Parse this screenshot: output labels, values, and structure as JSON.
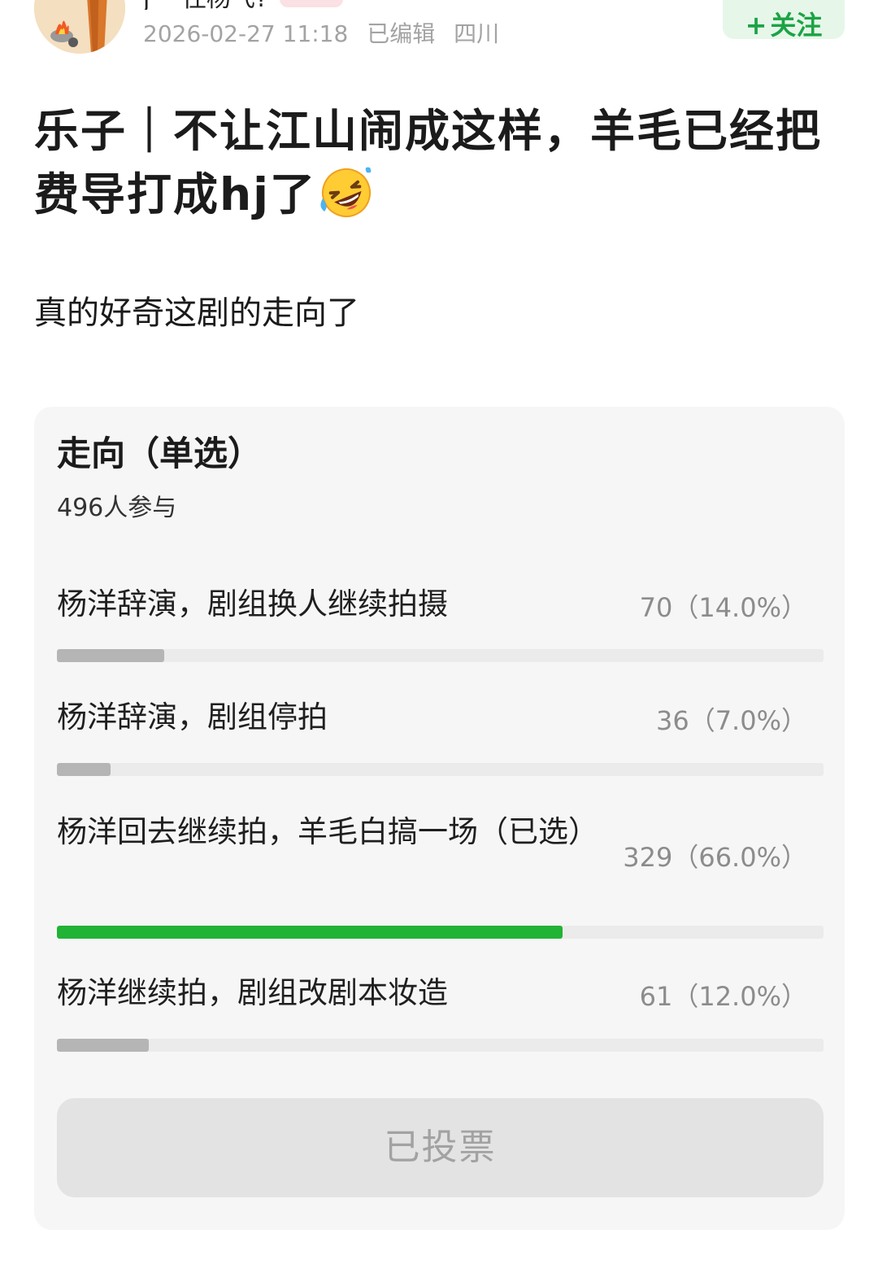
{
  "header": {
    "username": "j 一往杨飞?",
    "timestamp": "2026-02-27 11:18",
    "edited": "已编辑",
    "location": "四川",
    "follow_plus": "+",
    "follow_label": "关注"
  },
  "post": {
    "title": "乐子｜不让江山闹成这样，羊毛已经把费导打成hj了",
    "emoji": "rolling-on-the-floor-laughing",
    "body": "真的好奇这剧的走向了"
  },
  "poll": {
    "title": "走向（单选）",
    "participants": "496人参与",
    "options": [
      {
        "label": "杨洋辞演，剧组换人继续拍摄",
        "stats": "70（14.0%）",
        "percent": 14.0,
        "selected": false
      },
      {
        "label": "杨洋辞演，剧组停拍",
        "stats": "36（7.0%）",
        "percent": 7.0,
        "selected": false
      },
      {
        "label": "杨洋回去继续拍，羊毛白搞一场（已选）",
        "stats": "329（66.0%）",
        "percent": 66.0,
        "selected": true
      },
      {
        "label": "杨洋继续拍，剧组改剧本妆造",
        "stats": "61（12.0%）",
        "percent": 12.0,
        "selected": false
      }
    ],
    "voted_label": "已投票"
  },
  "colors": {
    "accent_green": "#21b335",
    "follow_bg": "#e6f7ea",
    "bar_gray": "#b5b5b5",
    "track": "#ebebeb",
    "card_bg": "#f6f6f6"
  }
}
